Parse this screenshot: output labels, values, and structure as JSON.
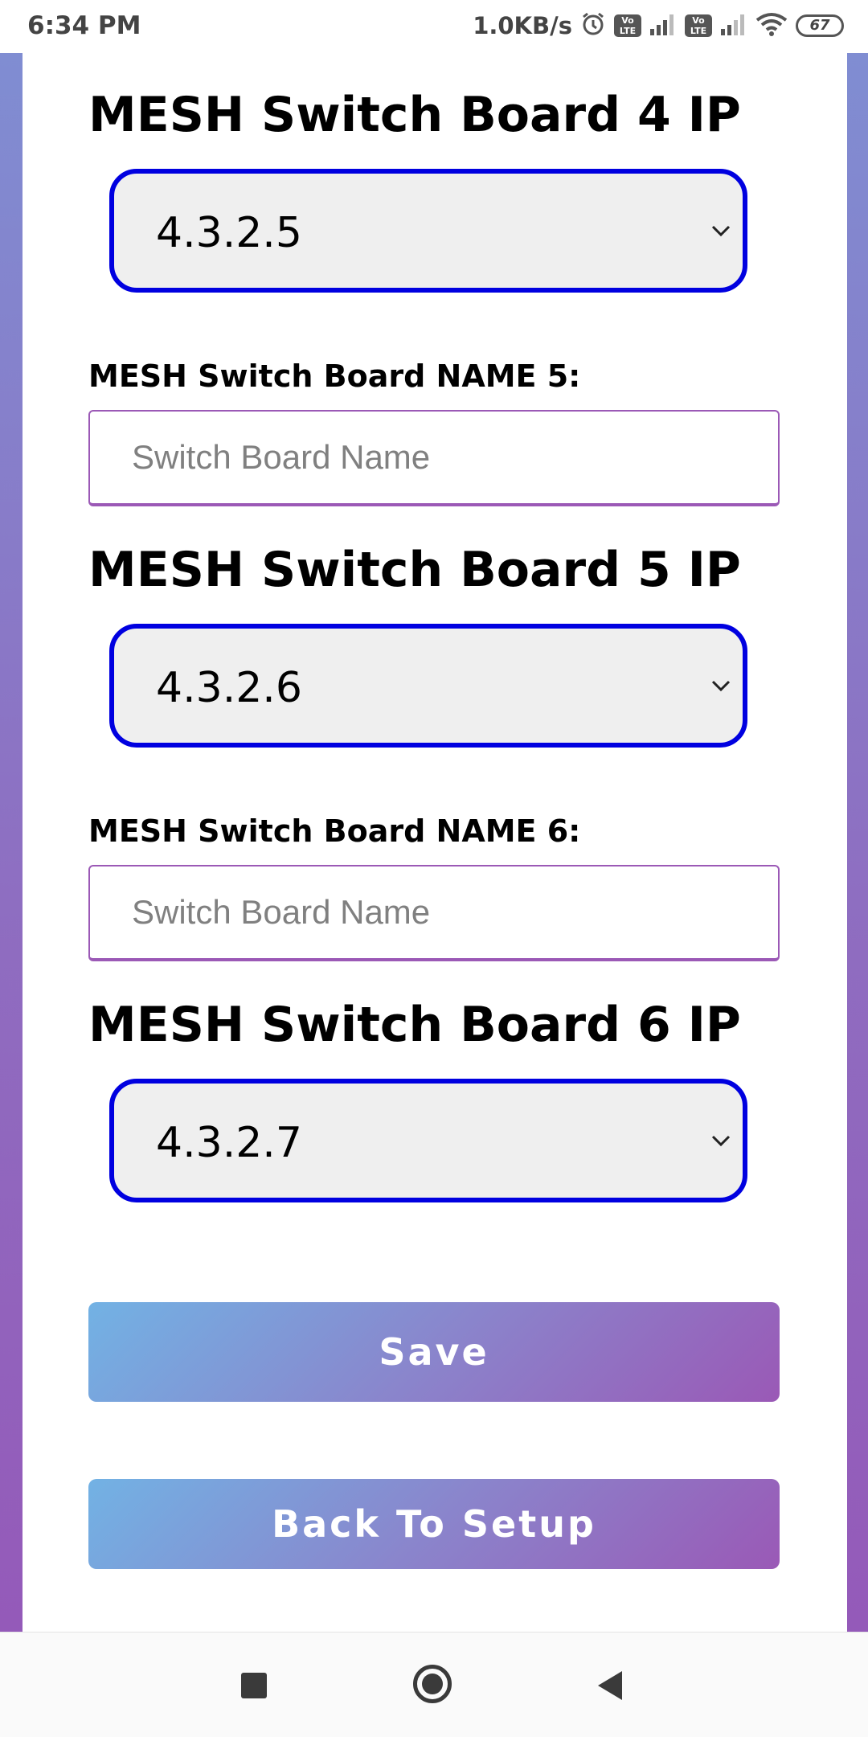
{
  "status_bar": {
    "time": "6:34 PM",
    "net_speed": "1.0KB/s",
    "volte_label": "Vo LTE",
    "battery": "67",
    "icons": [
      "alarm-icon",
      "volte-icon",
      "signal-icon",
      "wifi-icon",
      "battery-icon"
    ]
  },
  "form": {
    "board4": {
      "heading": "MESH Switch Board 4 IP",
      "ip": "4.3.2.5"
    },
    "name5": {
      "label": "MESH Switch Board NAME 5:",
      "placeholder": "Switch Board Name",
      "value": ""
    },
    "board5": {
      "heading": "MESH Switch Board 5 IP",
      "ip": "4.3.2.6"
    },
    "name6": {
      "label": "MESH Switch Board NAME 6:",
      "placeholder": "Switch Board Name",
      "value": ""
    },
    "board6": {
      "heading": "MESH Switch Board 6 IP",
      "ip": "4.3.2.7"
    }
  },
  "buttons": {
    "save": "Save",
    "back": "Back To Setup"
  },
  "colors": {
    "select_border": "#0000e0",
    "select_fill": "#efefef",
    "input_border": "#9b59b6",
    "button_gradient_start": "#72b2e4",
    "button_gradient_end": "#9a59b6"
  },
  "nav": {
    "icons": [
      "recents-square-icon",
      "home-circle-icon",
      "back-triangle-icon"
    ]
  }
}
